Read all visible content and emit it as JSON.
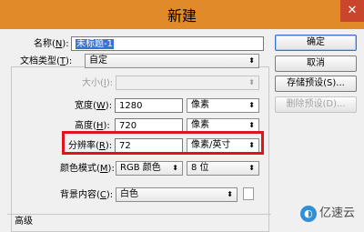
{
  "window": {
    "title": "新建",
    "close_glyph": "✕"
  },
  "fields": {
    "name": {
      "label_pre": "名称(",
      "key": "N",
      "label_post": "):",
      "value": "未标题-1"
    },
    "doc_type": {
      "label_pre": "文档类型(",
      "key": "T",
      "label_post": "):",
      "value": "自定"
    },
    "size": {
      "label_pre": "大小(",
      "key": "I",
      "label_post": "):"
    },
    "width": {
      "label_pre": "宽度(",
      "key": "W",
      "label_post": "):",
      "value": "1280",
      "unit": "像素"
    },
    "height": {
      "label_pre": "高度(",
      "key": "H",
      "label_post": "):",
      "value": "720",
      "unit": "像素"
    },
    "resolution": {
      "label_pre": "分辨率(",
      "key": "R",
      "label_post": "):",
      "value": "72",
      "unit": "像素/英寸"
    },
    "color_mode": {
      "label_pre": "颜色模式(",
      "key": "M",
      "label_post": "):",
      "value": "RGB 颜色",
      "depth": "8 位"
    },
    "background": {
      "label_pre": "背景内容(",
      "key": "C",
      "label_post": "):",
      "value": "白色"
    },
    "advanced": {
      "label": "高级"
    }
  },
  "buttons": {
    "ok": "确定",
    "cancel": "取消",
    "save_preset": "存储预设(S)...",
    "delete_preset": "删除预设(D)..."
  },
  "watermark": {
    "text": "亿速云"
  },
  "colors": {
    "title_bar": "#e08a2a",
    "highlight": "#e0141c",
    "selection": "#3874d8"
  }
}
